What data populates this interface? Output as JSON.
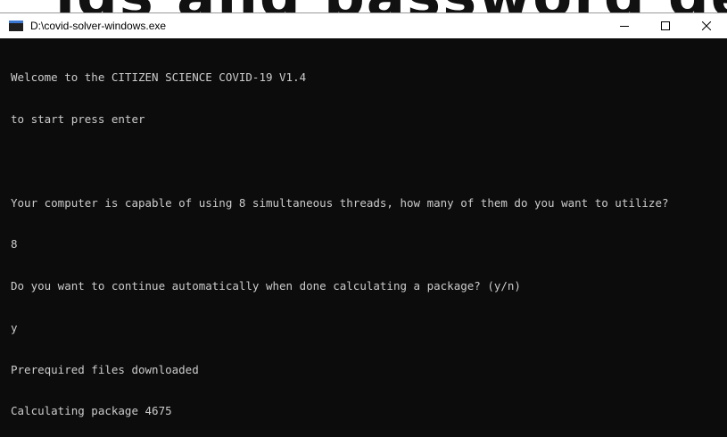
{
  "background_heading": "igs and password ge",
  "window": {
    "title": "D:\\covid-solver-windows.exe"
  },
  "caption_buttons": {
    "minimize_icon": "minimize-icon",
    "maximize_icon": "maximize-icon",
    "close_icon": "close-icon"
  },
  "console": {
    "lines": [
      "Welcome to the CITIZEN SCIENCE COVID-19 V1.4",
      "to start press enter",
      "",
      "Your computer is capable of using 8 simultaneous threads, how many of them do you want to utilize?",
      "8",
      "Do you want to continue automatically when done calculating a package? (y/n)",
      "y",
      "Prerequired files downloaded",
      "Calculating package 4675"
    ]
  },
  "colors": {
    "console_background": "#0c0c0c",
    "console_text": "#cccccc",
    "titlebar_background": "#ffffff"
  }
}
